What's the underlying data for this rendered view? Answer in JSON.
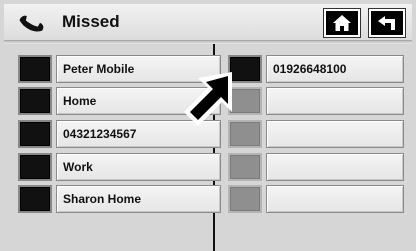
{
  "header": {
    "title": "Missed",
    "phone_icon": "phone-handset-icon",
    "home_icon": "home-icon",
    "back_icon": "back-arrow-icon"
  },
  "missed_calls": [
    {
      "name": "Peter Mobile"
    },
    {
      "name": "Home"
    },
    {
      "name": "04321234567"
    },
    {
      "name": "Work"
    },
    {
      "name": "Sharon Home"
    }
  ],
  "detail_numbers": [
    {
      "number": "01926648100"
    },
    {
      "number": ""
    },
    {
      "number": ""
    },
    {
      "number": ""
    },
    {
      "number": ""
    }
  ],
  "colors": {
    "background": "#d6d6d6",
    "active_swatch": "#111111",
    "inactive_swatch": "#8f8f8f"
  },
  "cursor": "pointer-arrow-icon"
}
